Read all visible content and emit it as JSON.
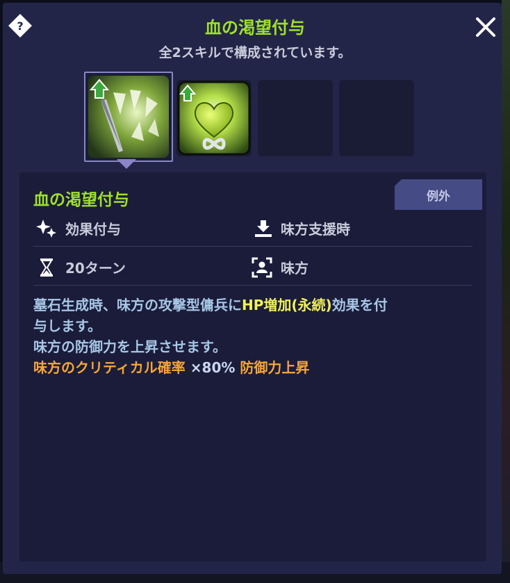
{
  "header": {
    "title": "血の渇望付与",
    "subtitle": "全2スキルで構成されています。",
    "help_icon": "question-diamond-icon",
    "close_icon": "close-x-icon"
  },
  "skills_bar": {
    "slots": [
      {
        "icon": "fangs-blade-icon",
        "upgrade_badge": true,
        "selected": true
      },
      {
        "icon": "green-heart-infinity-icon",
        "upgrade_badge": true,
        "selected": false
      },
      {
        "icon": "empty-slot",
        "upgrade_badge": false,
        "selected": false
      },
      {
        "icon": "empty-slot",
        "upgrade_badge": false,
        "selected": false
      }
    ]
  },
  "detail": {
    "name": "血の渇望付与",
    "tag": "例外",
    "effect_type": "効果付与",
    "trigger": "味方支援時",
    "duration": "20ターン",
    "target": "味方",
    "desc_line1_a": "墓石生成時、味方の攻撃型傭兵に",
    "desc_line1_b": "HP増加(永続)",
    "desc_line1_c": "効果を付",
    "desc_line2": "与します。",
    "desc_line3": "味方の防御力を上昇させます。",
    "desc_line4_a": "味方のクリティカル確率",
    "desc_line4_b": " ×80% ",
    "desc_line4_c": "防御力上昇"
  },
  "colors": {
    "title_green": "#9ee22a",
    "panel_bg": "#232548",
    "highlight_yellow": "#f0f25a",
    "highlight_orange": "#f6a637"
  }
}
